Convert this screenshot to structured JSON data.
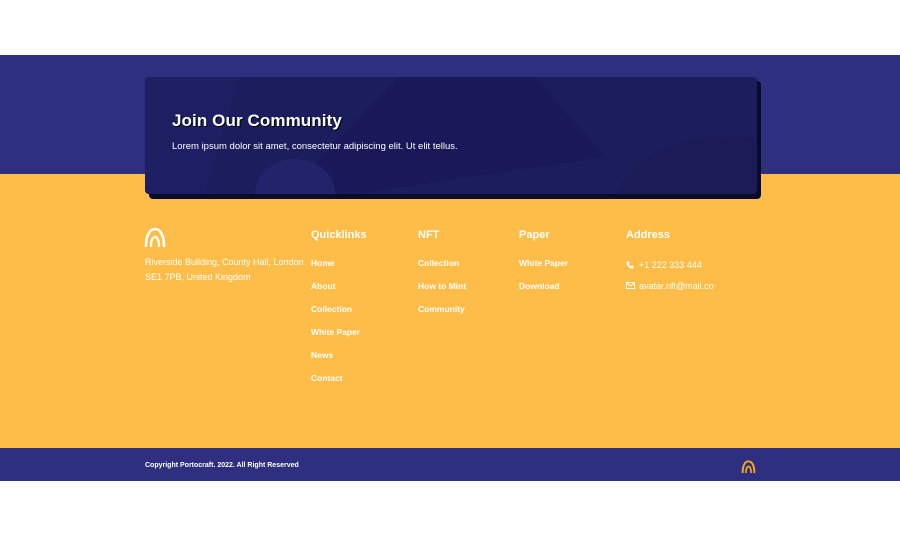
{
  "community": {
    "title": "Join Our Community",
    "text": "Lorem ipsum dolor sit amet, consectetur adipiscing elit. Ut elit tellus."
  },
  "brand": {
    "logo_icon": "arch-logo-icon",
    "address": "Riverside Building, County Hall, London SE1 7PB, United Kingdom"
  },
  "quicklinks": {
    "title": "Quicklinks",
    "links": [
      "Home",
      "About",
      "Collection",
      "White Paper",
      "News",
      "Contact"
    ]
  },
  "nft": {
    "title": "NFT",
    "links": [
      "Collection",
      "How to Mint",
      "Community"
    ]
  },
  "paper": {
    "title": "Paper",
    "links": [
      "White Paper",
      "Download"
    ]
  },
  "contact": {
    "title": "Address",
    "phone": "+1 222 333 444",
    "email": "avatar.nft@mail.co"
  },
  "footer": {
    "copyright": "Copyright Portocraft. 2022. All Right Reserved"
  },
  "colors": {
    "navy": "#2e2f7e",
    "card": "#1c1d5c",
    "yellow": "#fdbd48",
    "accent": "#f5a623"
  }
}
